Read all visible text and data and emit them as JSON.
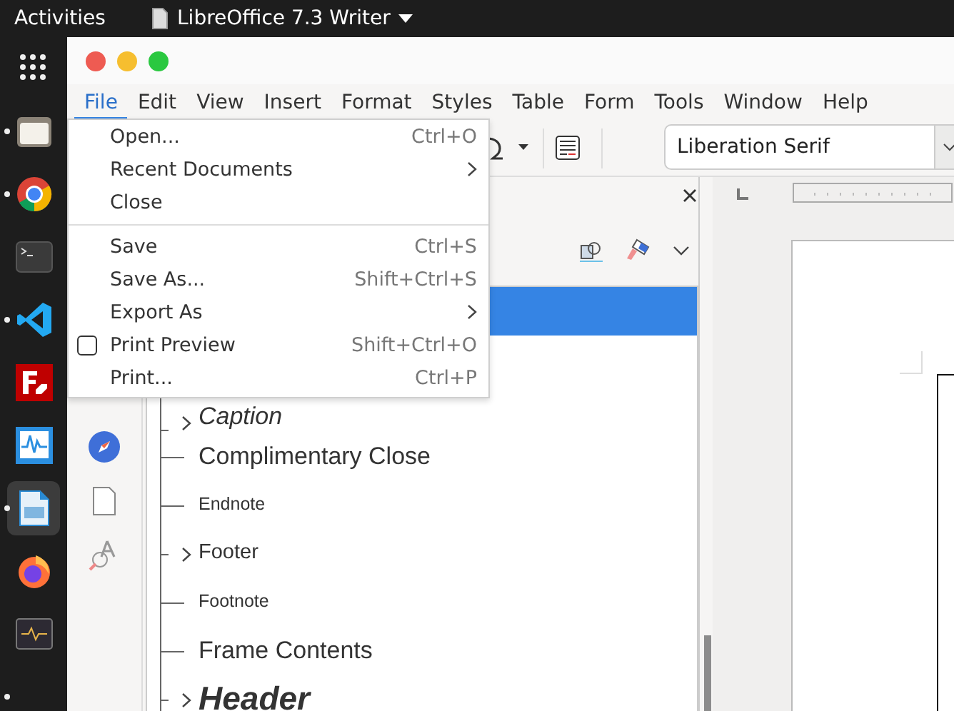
{
  "top_bar": {
    "activities": "Activities",
    "app_menu": "LibreOffice 7.3 Writer"
  },
  "dock": {
    "items": [
      {
        "kind": "grid",
        "running": false,
        "selected": false
      },
      {
        "kind": "folder",
        "running": true,
        "selected": false
      },
      {
        "kind": "browser",
        "running": true,
        "selected": false
      },
      {
        "kind": "terminal",
        "running": false,
        "selected": false
      },
      {
        "kind": "editor",
        "running": true,
        "selected": false
      },
      {
        "kind": "transfer",
        "running": false,
        "selected": false
      },
      {
        "kind": "waveform",
        "running": false,
        "selected": false
      },
      {
        "kind": "document",
        "running": true,
        "selected": true
      },
      {
        "kind": "fox",
        "running": false,
        "selected": false
      },
      {
        "kind": "activity",
        "running": false,
        "selected": false
      },
      {
        "kind": "hidden",
        "running": true,
        "selected": false
      }
    ]
  },
  "window": {
    "menu_bar": [
      {
        "label": "File",
        "selected": true
      },
      {
        "label": "Edit",
        "selected": false
      },
      {
        "label": "View",
        "selected": false
      },
      {
        "label": "Insert",
        "selected": false
      },
      {
        "label": "Format",
        "selected": false
      },
      {
        "label": "Styles",
        "selected": false
      },
      {
        "label": "Table",
        "selected": false
      },
      {
        "label": "Form",
        "selected": false
      },
      {
        "label": "Tools",
        "selected": false
      },
      {
        "label": "Window",
        "selected": false
      },
      {
        "label": "Help",
        "selected": false
      }
    ],
    "file_menu": [
      {
        "kind": "command",
        "label": "Open...",
        "shortcut": "Ctrl+O"
      },
      {
        "kind": "submenu",
        "label": "Recent Documents"
      },
      {
        "kind": "command",
        "label": "Close"
      },
      {
        "kind": "separator"
      },
      {
        "kind": "command",
        "label": "Save",
        "shortcut": "Ctrl+S"
      },
      {
        "kind": "command",
        "label": "Save As...",
        "shortcut": "Shift+Ctrl+S"
      },
      {
        "kind": "submenu",
        "label": "Export As"
      },
      {
        "kind": "check",
        "label": "Print Preview",
        "shortcut": "Shift+Ctrl+O",
        "checked": false
      },
      {
        "kind": "command",
        "label": "Print...",
        "shortcut": "Ctrl+P"
      }
    ],
    "toolbar": {
      "font_name": "Liberation Serif"
    },
    "styles_panel": {
      "rows": [
        {
          "kind": "covered",
          "selected": true
        },
        {
          "kind": "covered",
          "selected": false
        },
        {
          "kind": "caption",
          "label": "Caption",
          "expandable": true,
          "selected": false
        },
        {
          "kind": "large",
          "label": "Complimentary Close",
          "expandable": false,
          "selected": false
        },
        {
          "kind": "small",
          "label": "Endnote",
          "expandable": false,
          "selected": false
        },
        {
          "kind": "medium",
          "label": "Footer",
          "expandable": true,
          "selected": false
        },
        {
          "kind": "small",
          "label": "Footnote",
          "expandable": false,
          "selected": false
        },
        {
          "kind": "large",
          "label": "Frame Contents",
          "expandable": false,
          "selected": false
        },
        {
          "kind": "heading",
          "label": "Header",
          "expandable": true,
          "selected": false
        }
      ]
    }
  }
}
